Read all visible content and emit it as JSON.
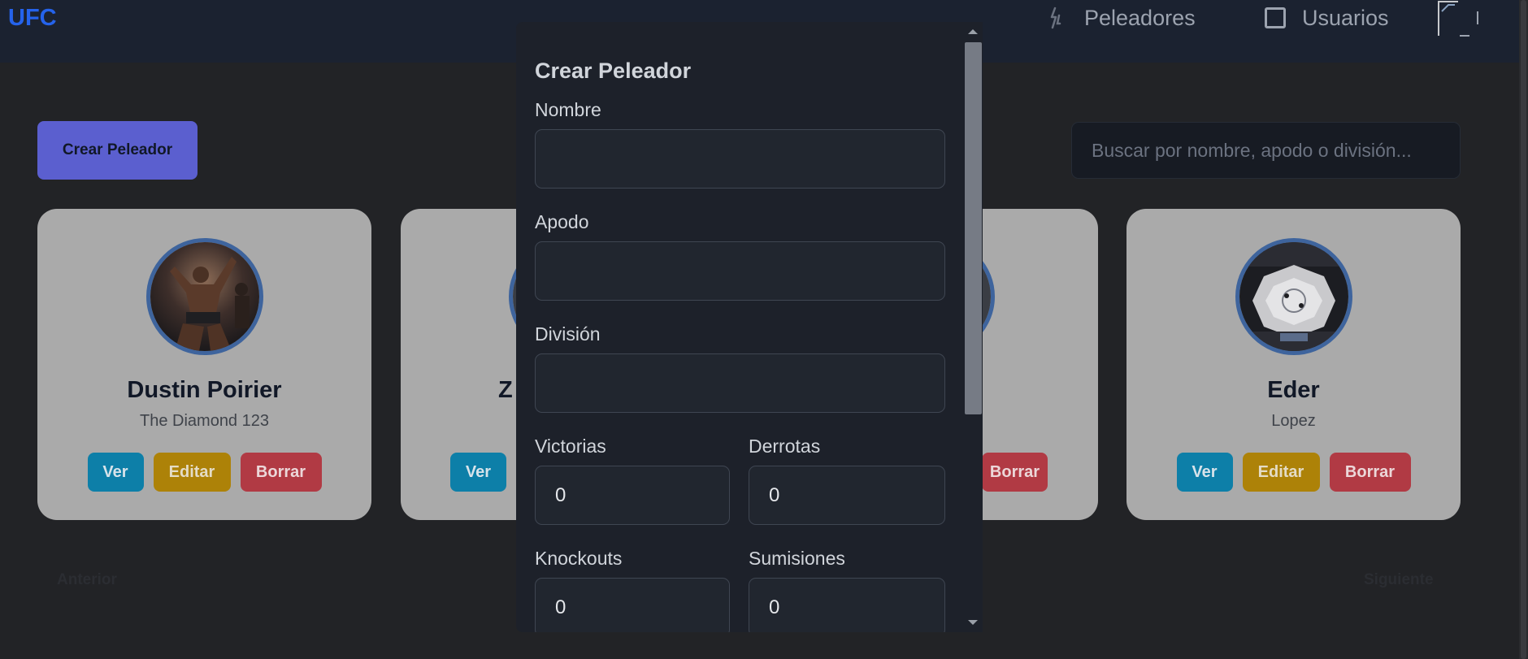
{
  "navbar": {
    "brand": "UFC",
    "peleadores_label": "Peleadores",
    "usuarios_label": "Usuarios"
  },
  "toolbar": {
    "create_label": "Crear Peleador",
    "search_placeholder": "Buscar por nombre, apodo o división..."
  },
  "cards": [
    {
      "name": "Dustin Poirier",
      "nickname": "The Diamond 123",
      "ver": "Ver",
      "editar": "Editar",
      "borrar": "Borrar"
    },
    {
      "name": "Z",
      "ver": "Ver"
    },
    {
      "borrar": "Borrar"
    },
    {
      "name": "Eder",
      "nickname": "Lopez",
      "ver": "Ver",
      "editar": "Editar",
      "borrar": "Borrar"
    }
  ],
  "pagination": {
    "prev": "Anterior",
    "next": "Siguiente"
  },
  "modal": {
    "title": "Crear Peleador",
    "nombre_label": "Nombre",
    "nombre_value": "",
    "apodo_label": "Apodo",
    "apodo_value": "",
    "division_label": "División",
    "division_value": "",
    "victorias_label": "Victorias",
    "victorias_value": "0",
    "derrotas_label": "Derrotas",
    "derrotas_value": "0",
    "knockouts_label": "Knockouts",
    "knockouts_value": "0",
    "sumisiones_label": "Sumisiones",
    "sumisiones_value": "0"
  },
  "colors": {
    "brand": "#2563eb",
    "primary_button": "#5b5fcf",
    "ver": "#0d7fa8",
    "editar": "#ad8208",
    "borrar": "#b13a44"
  }
}
